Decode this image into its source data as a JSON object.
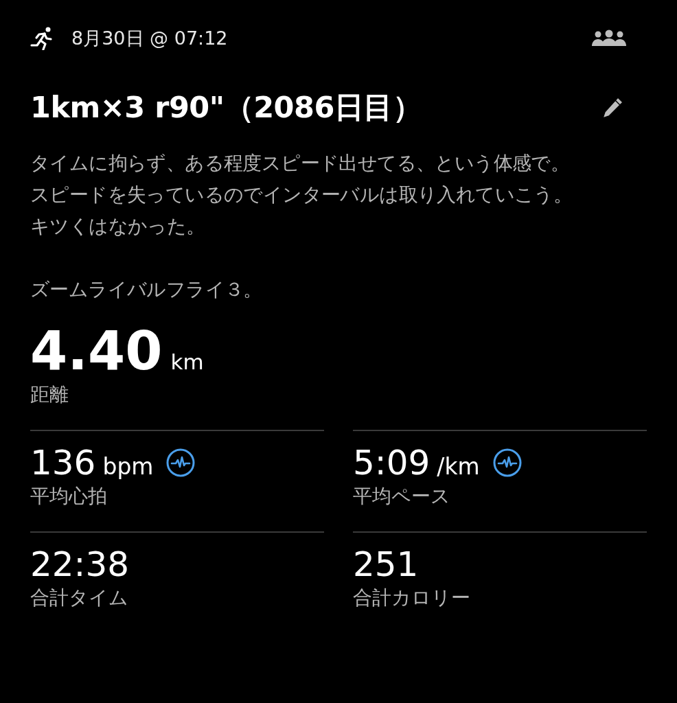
{
  "header": {
    "date": "8月30日 @ 07:12"
  },
  "title": "1km×3 r90\"（2086日目）",
  "description": [
    [
      "タイムに拘らず、ある程度スピード出せてる、という体感で。",
      "スピードを失っているのでインターバルは取り入れていこう。",
      "キツくはなかった。"
    ],
    [
      "ズームライバルフライ３。"
    ]
  ],
  "distance": {
    "value": "4.40",
    "unit": "km",
    "label": "距離"
  },
  "stats": [
    {
      "value": "136",
      "unit": "bpm",
      "label": "平均心拍",
      "chart_link": true
    },
    {
      "value": "5:09",
      "unit": "/km",
      "label": "平均ペース",
      "chart_link": true
    },
    {
      "value": "22:38",
      "label": "合計タイム",
      "chart_link": false
    },
    {
      "value": "251",
      "label": "合計カロリー",
      "chart_link": false
    }
  ]
}
